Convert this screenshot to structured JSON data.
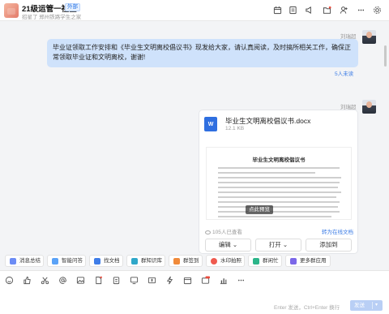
{
  "header": {
    "title": "21级运管一社区",
    "tag": "外部",
    "subtitle": "招星了 郑州铁路学生之家",
    "icons": [
      "calendar-icon",
      "list-icon",
      "announcement-icon",
      "mute-icon",
      "folder-icon",
      "add-member-icon",
      "more-icon",
      "settings-icon"
    ]
  },
  "messages": [
    {
      "sender": "刘瑞超",
      "text": "毕业证领取工作安排和《毕业生文明离校倡议书》现发给大家，请认真阅读，及时搞所相关工作，确保正常领取毕业证和文明离校，谢谢!",
      "read_status": "5人未读"
    },
    {
      "sender": "刘瑞超",
      "file": {
        "name": "毕业生文明离校倡议书.docx",
        "size": "12.1 KB",
        "icon_letter": "W",
        "preview_title": "毕业生文明离校倡议书",
        "preview_button": "点此预览",
        "views": "105人已查看",
        "open_link": "转为在线文档",
        "buttons": [
          "编辑 ⌄",
          "打开 ⌄",
          "添加到"
        ]
      }
    }
  ],
  "toolbar": [
    {
      "label": "消息总结",
      "color": "#6c8cf5"
    },
    {
      "label": "智能问答",
      "color": "#5aa2f7"
    },
    {
      "label": "找文档",
      "color": "#3f7de8"
    },
    {
      "label": "群知识库",
      "color": "#2fa7c9"
    },
    {
      "label": "群签到",
      "color": "#f08a3a"
    },
    {
      "label": "水印拍照",
      "color": "#ef5a4f"
    },
    {
      "label": "群闲忙",
      "color": "#2cb58a"
    },
    {
      "label": "更多群应用",
      "color": "#7b67e8"
    }
  ],
  "input": {
    "icons": [
      "emoji-icon",
      "thumb-icon",
      "scissors-icon",
      "mention-icon",
      "image-icon",
      "file-icon",
      "clipboard-icon",
      "screen-icon",
      "money-icon",
      "flash-icon",
      "calendar-icon",
      "live-icon",
      "chart-icon",
      "more-icon"
    ],
    "hint": "Enter 发送，Ctrl+Enter 换行",
    "send_label": "发送"
  }
}
